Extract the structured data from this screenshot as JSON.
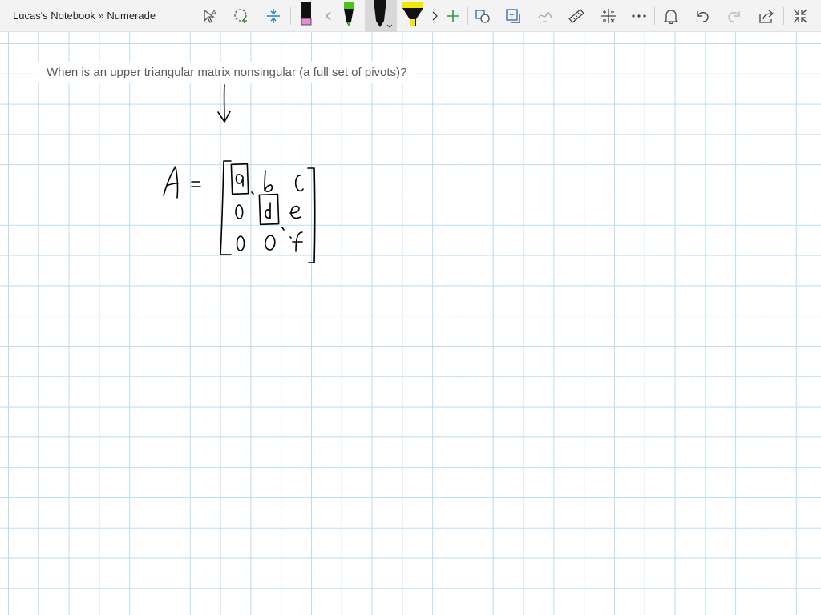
{
  "window": {
    "title": "Lucas's Notebook » Numerade"
  },
  "toolbar": {
    "icons": [
      "text-select-icon",
      "lasso-select-icon",
      "insert-space-icon",
      "pen-pink-icon",
      "scroll-left-icon",
      "pen-green-icon",
      "pen-black-icon",
      "highlighter-yellow-icon",
      "scroll-right-icon",
      "add-pen-icon",
      "ink-to-shape-icon",
      "ink-to-text-icon",
      "ink-replay-icon",
      "ruler-icon",
      "math-icon",
      "more-icon",
      "notifications-icon",
      "undo-icon",
      "redo-icon",
      "share-icon",
      "fullscreen-icon"
    ],
    "colors": {
      "pink": "#e68bd6",
      "green": "#4cc417",
      "black": "#111111",
      "yellow": "#f3e600",
      "accent_blue": "#1f7ac8"
    }
  },
  "page": {
    "prompt": "When is an upper triangular matrix nonsingular (a full set of pivots)?",
    "grid_color": "#b9dcf2"
  },
  "handwriting": {
    "lhs": "A",
    "equals": "=",
    "matrix": [
      [
        "a",
        "b",
        "c"
      ],
      [
        "0",
        "d",
        "e"
      ],
      [
        "0",
        "0",
        "f"
      ]
    ],
    "boxed_entries": [
      "a",
      "d"
    ]
  }
}
